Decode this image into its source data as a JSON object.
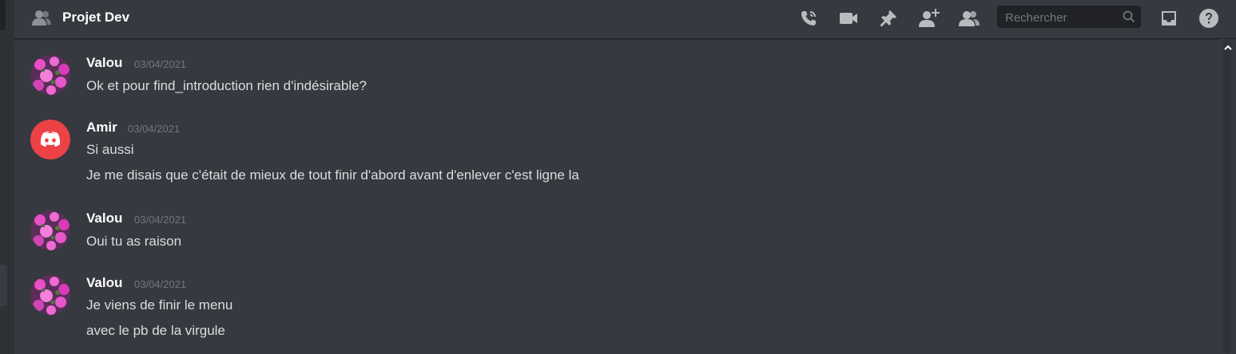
{
  "header": {
    "title": "Projet Dev",
    "icons": [
      "call-icon",
      "video-icon",
      "pin-icon",
      "add-member-icon",
      "members-icon",
      "inbox-icon",
      "help-icon"
    ]
  },
  "search": {
    "placeholder": "Rechercher"
  },
  "colors": {
    "background": "#36393f",
    "header_border": "#202225",
    "author": "#ffffff",
    "text": "#dcddde",
    "timestamp": "#72767d",
    "discord_red": "#ed4245"
  },
  "messages": [
    {
      "author": "Valou",
      "timestamp": "03/04/2021",
      "avatar": "flower-avatar",
      "lines": [
        "Ok et pour find_introduction rien d'indésirable?"
      ]
    },
    {
      "author": "Amir",
      "timestamp": "03/04/2021",
      "avatar": "discord-default-avatar",
      "lines": [
        "Si aussi",
        "Je me disais que c'était de mieux de tout finir d'abord avant d'enlever c'est ligne la"
      ]
    },
    {
      "author": "Valou",
      "timestamp": "03/04/2021",
      "avatar": "flower-avatar",
      "lines": [
        "Oui tu as raison"
      ]
    },
    {
      "author": "Valou",
      "timestamp": "03/04/2021",
      "avatar": "flower-avatar",
      "lines": [
        "Je viens de finir le menu",
        "avec le pb de la virgule"
      ]
    }
  ]
}
